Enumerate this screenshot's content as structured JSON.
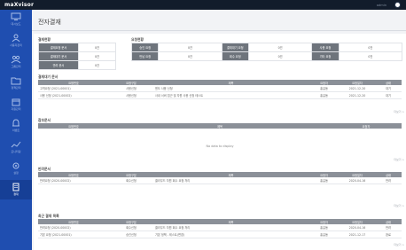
{
  "app": {
    "logo": "maXvisor",
    "user_label": "admin"
  },
  "sidebar": {
    "items": [
      {
        "label": "대시보드",
        "icon": "monitor-icon"
      },
      {
        "label": "사용자관리",
        "icon": "users-icon"
      },
      {
        "label": "그룹관리",
        "icon": "group-icon"
      },
      {
        "label": "정책관리",
        "icon": "folder-icon"
      },
      {
        "label": "자원관리",
        "icon": "box-icon"
      },
      {
        "label": "이벤트",
        "icon": "bell-icon"
      },
      {
        "label": "모니터링",
        "icon": "chart-icon"
      },
      {
        "label": "설정",
        "icon": "gear-icon"
      },
      {
        "label": "결재",
        "icon": "document-icon"
      }
    ]
  },
  "page": {
    "title": "전자결재"
  },
  "approval_status": {
    "title": "결재현황",
    "rows": [
      {
        "label": "결재요청 문서",
        "value": "0건"
      },
      {
        "label": "결재대기 문서",
        "value": "0건"
      },
      {
        "label": "반려 문서",
        "value": "0건"
      }
    ]
  },
  "request_status": {
    "title": "요청현황",
    "cells": [
      {
        "label": "승인 요청",
        "value": "0건"
      },
      {
        "label": "결재대기 요청",
        "value": "0건"
      },
      {
        "label": "사용 요청",
        "value": "0건"
      },
      {
        "label": "반납 요청",
        "value": "0건"
      },
      {
        "label": "회수 요청",
        "value": "0건"
      },
      {
        "label": "기타 요청",
        "value": "0건"
      }
    ]
  },
  "sections": [
    {
      "title": "결재대기 문서",
      "columns": [
        "요청번호",
        "요청구분",
        "제목",
        "요청자",
        "요청일자",
        "상태"
      ],
      "rows": [
        [
          "고객요청 (2021-00001)",
          "사용신청",
          "윈도 사용 신청",
          "홍길동",
          "2021-12-20",
          "대기"
        ],
        [
          "사용 신청 (2021-00002)",
          "사용신청",
          "사내 서버 접근 및 자원 사용 신청 테스트",
          "홍길동",
          "2021-12-20",
          "대기"
        ]
      ],
      "empty": "",
      "more": "더보기 >"
    },
    {
      "title": "참조문서",
      "columns": [
        "요청번호",
        "제목",
        "요청자"
      ],
      "rows": [],
      "empty": "No data to display",
      "more": "더보기 >"
    },
    {
      "title": "반려문서",
      "columns": [
        "요청번호",
        "요청구분",
        "제목",
        "요청자",
        "요청일자",
        "상태"
      ],
      "rows": [
        [
          "반려요청 (2020-00002)",
          "회수신청",
          "클라우드 자원 회수 요청 처리",
          "홍길동",
          "2020-04-16",
          "반려"
        ]
      ],
      "empty": "",
      "more": "더보기 >"
    },
    {
      "title": "최근 결재 목록",
      "columns": [
        "요청번호",
        "요청구분",
        "제목",
        "요청자",
        "요청일자",
        "상태"
      ],
      "rows": [
        [
          "반려요청 (2020-00002)",
          "회수신청",
          "클라우드 자원 회수 요청 처리",
          "홍길동",
          "2020-04-16",
          "반려"
        ],
        [
          "기본 요청 (2021-00001)",
          "승인신청",
          "기본 정책 - 테스트(변경)",
          "홍길동",
          "2021-12-17",
          "완료"
        ]
      ],
      "empty": "",
      "more": "더보기 >"
    }
  ]
}
